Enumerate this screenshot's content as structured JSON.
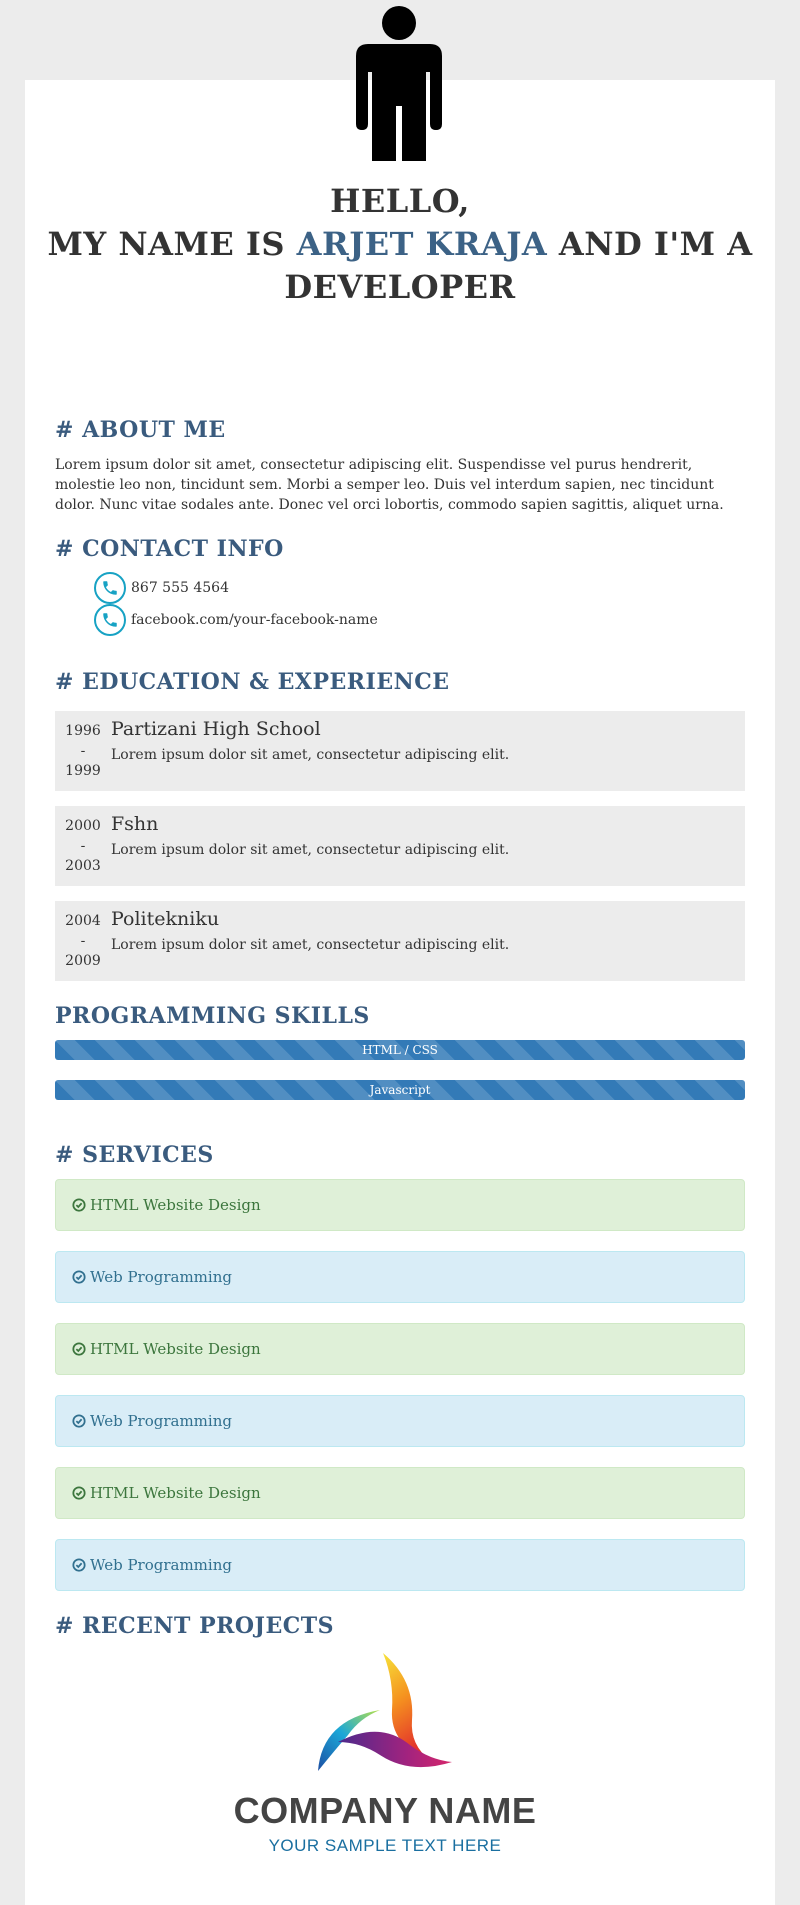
{
  "hero": {
    "line1": "HELLO,",
    "prefix": "MY NAME IS ",
    "name": "ARJET KRAJA",
    "suffix": " AND I'M A",
    "line3": "DEVELOPER"
  },
  "about": {
    "title": "# ABOUT ME",
    "text": "Lorem ipsum dolor sit amet, consectetur adipiscing elit. Suspendisse vel purus hendrerit, molestie leo non, tincidunt sem. Morbi a semper leo. Duis vel interdum sapien, nec tincidunt dolor. Nunc vitae sodales ante. Donec vel orci lobortis, commodo sapien sagittis, aliquet urna."
  },
  "contact": {
    "title": "# CONTACT INFO",
    "items": [
      {
        "icon": "phone-icon",
        "text": "867 555 4564"
      },
      {
        "icon": "phone-icon",
        "text": "facebook.com/your-facebook-name"
      }
    ]
  },
  "education": {
    "title": "# EDUCATION & EXPERIENCE",
    "items": [
      {
        "start": "1996",
        "sep": "-",
        "end": "1999",
        "institution": "Partizani High School",
        "desc": "Lorem ipsum dolor sit amet, consectetur adipiscing elit."
      },
      {
        "start": "2000",
        "sep": "-",
        "end": "2003",
        "institution": "Fshn",
        "desc": "Lorem ipsum dolor sit amet, consectetur adipiscing elit."
      },
      {
        "start": "2004",
        "sep": "-",
        "end": "2009",
        "institution": "Politekniku",
        "desc": "Lorem ipsum dolor sit amet, consectetur adipiscing elit."
      }
    ]
  },
  "skills": {
    "title": "PROGRAMMING SKILLS",
    "items": [
      {
        "label": "HTML / CSS",
        "level": 100
      },
      {
        "label": "Javascript",
        "level": 100
      }
    ]
  },
  "services": {
    "title": "# SERVICES",
    "items": [
      {
        "label": "HTML Website Design",
        "color": "#dff0d8"
      },
      {
        "label": "Web Programming",
        "color": "#d9edf7"
      },
      {
        "label": "HTML Website Design",
        "color": "#dff0d8"
      },
      {
        "label": "Web Programming",
        "color": "#d9edf7"
      },
      {
        "label": "HTML Website Design",
        "color": "#dff0d8"
      },
      {
        "label": "Web Programming",
        "color": "#d9edf7"
      }
    ]
  },
  "projects": {
    "title": "# RECENT PROJECTS",
    "company_name": "COMPANY NAME",
    "company_tagline": "YOUR SAMPLE TEXT HERE"
  },
  "colors": {
    "accent": "#3a5b7e",
    "page_bg": "#ececec",
    "skill_bar": "#337ab7"
  }
}
